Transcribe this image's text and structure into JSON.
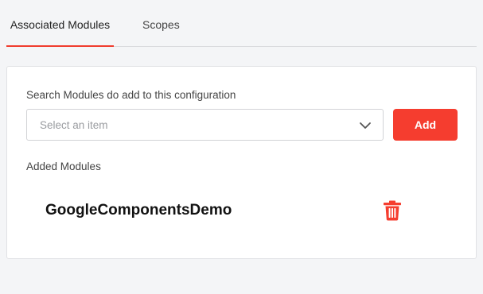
{
  "tabs": [
    {
      "label": "Associated Modules",
      "active": true
    },
    {
      "label": "Scopes",
      "active": false
    }
  ],
  "search": {
    "label": "Search Modules do add to this configuration",
    "placeholder": "Select an item",
    "add_label": "Add"
  },
  "added": {
    "label": "Added Modules",
    "modules": [
      {
        "name": "GoogleComponentsDemo"
      }
    ]
  },
  "icons": {
    "dropdown": "chevron-down-icon",
    "delete": "trash-icon"
  },
  "colors": {
    "accent": "#f53d2f",
    "background": "#f4f5f7",
    "card": "#ffffff"
  }
}
